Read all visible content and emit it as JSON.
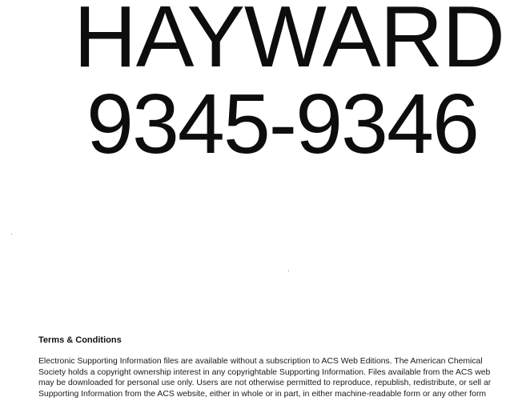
{
  "document": {
    "title": "HAYWARD",
    "number": "9345-9346"
  },
  "terms": {
    "heading": "Terms & Conditions",
    "lines": [
      "Electronic Supporting Information files are available without a subscription to ACS Web Editions. The American Chemical",
      "Society holds a copyright ownership interest in any copyrightable Supporting Information. Files available from the ACS web",
      "may be downloaded for personal use only. Users are not otherwise permitted to reproduce, republish, redistribute, or sell ar",
      "Supporting Information from the ACS website, either in whole or in part, in either machine-readable form or any other form"
    ]
  }
}
